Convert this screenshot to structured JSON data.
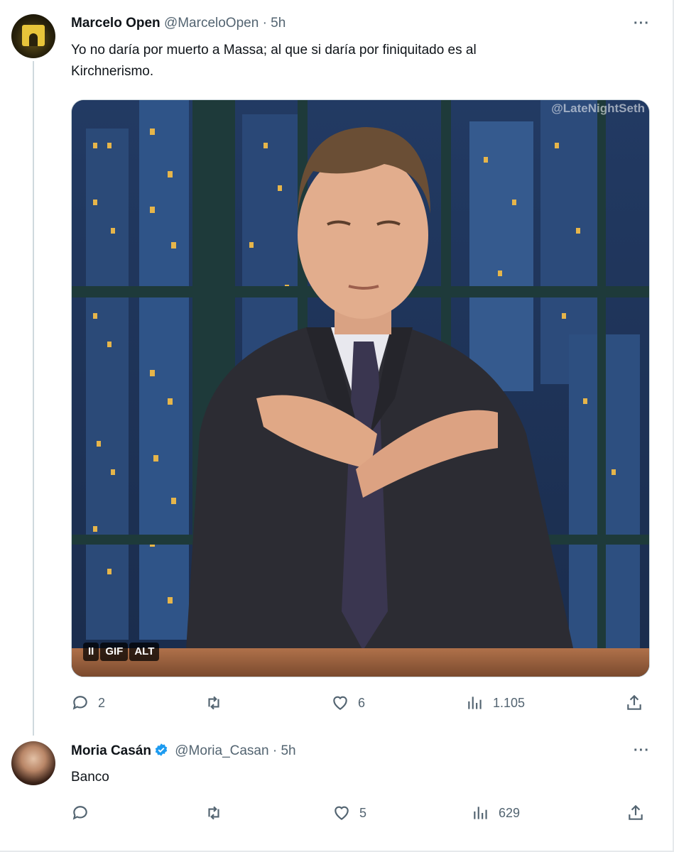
{
  "tweets": [
    {
      "name": "Marcelo Open",
      "handle": "@MarceloOpen",
      "separator": "·",
      "time": "5h",
      "more": "···",
      "text_line1": "Yo no daría por muerto a Massa; al que si daría por finiquitado es al",
      "text_line2": "Kirchnerismo.",
      "media": {
        "watermark": "@LateNightSeth",
        "pause": "II",
        "gif": "GIF",
        "alt": "ALT"
      },
      "stats": {
        "replies": "2",
        "retweets": "",
        "likes": "6",
        "views": "1.105"
      }
    },
    {
      "name": "Moria Casán",
      "handle": "@Moria_Casan",
      "separator": "·",
      "time": "5h",
      "more": "···",
      "text_line1": "Banco",
      "stats": {
        "replies": "",
        "retweets": "",
        "likes": "5",
        "views": "629"
      }
    }
  ],
  "colors": {
    "text": "#0f1419",
    "muted": "#536471",
    "verified": "#1d9bf0",
    "thread_line": "#cfd9de"
  }
}
